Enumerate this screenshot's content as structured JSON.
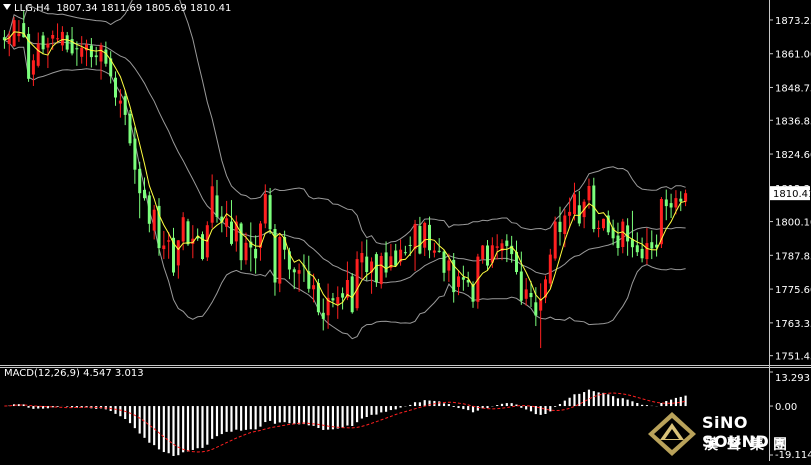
{
  "header": {
    "symbol": "LLG,H4",
    "open": "1807.34",
    "high": "1811.69",
    "low": "1805.69",
    "close": "1810.41"
  },
  "price_axis": {
    "labels": [
      "1873.25",
      "1861.00",
      "1848.75",
      "1836.85",
      "1824.60",
      "1812.35",
      "1800.10",
      "1787.85",
      "1775.60",
      "1763.35",
      "1751.45"
    ],
    "current_price": "1810.41"
  },
  "macd": {
    "label": "MACD(12,26,9) 4.547 3.013",
    "axis_labels": [
      "13.293",
      "0.00",
      "-19.114"
    ]
  },
  "logo": {
    "brand": "SiNO SOUND",
    "chinese": "漢聲集團"
  },
  "colors": {
    "background": "#000000",
    "bull_candle": "#ff2020",
    "bear_candle": "#7cff7c",
    "bollinger": "#9a9a9a",
    "moving_average": "#ffff40",
    "macd_histogram": "#ffffff",
    "macd_signal": "#ff2020",
    "current_price_label_bg": "#ffffff"
  },
  "chart_data": {
    "type": "candlestick",
    "y_range": [
      1751.45,
      1876
    ],
    "candles": [
      [
        1867,
        1869.6,
        1862.8,
        1865.9
      ],
      [
        1864.5,
        1869.1,
        1860.1,
        1867.6
      ],
      [
        1863.7,
        1874.3,
        1863.5,
        1873.2
      ],
      [
        1867.4,
        1873.2,
        1865.3,
        1868.4
      ],
      [
        1872.1,
        1876.6,
        1866.8,
        1867
      ],
      [
        1868.2,
        1870.7,
        1850.8,
        1851.9
      ],
      [
        1853.4,
        1860.8,
        1849.3,
        1858.6
      ],
      [
        1856.6,
        1868.7,
        1856,
        1864.7
      ],
      [
        1867.6,
        1868.9,
        1860.8,
        1862.6
      ],
      [
        1863.2,
        1866.8,
        1855.8,
        1864.7
      ],
      [
        1866.5,
        1869.4,
        1862.4,
        1867.8
      ],
      [
        1866.6,
        1872,
        1864.9,
        1866.6
      ],
      [
        1864,
        1871,
        1862,
        1868.9
      ],
      [
        1867.7,
        1868.9,
        1861.5,
        1862.5
      ],
      [
        1866.3,
        1870.7,
        1860.4,
        1861.1
      ],
      [
        1863,
        1865.5,
        1856.6,
        1862.6
      ],
      [
        1859.9,
        1867.4,
        1857.4,
        1863.2
      ],
      [
        1862.2,
        1866.1,
        1856.5,
        1864.3
      ],
      [
        1864,
        1866.7,
        1856,
        1859.8
      ],
      [
        1860.4,
        1863.5,
        1856.8,
        1859.8
      ],
      [
        1858.2,
        1865,
        1851.6,
        1864.1
      ],
      [
        1862.5,
        1865.4,
        1856.3,
        1857.4
      ],
      [
        1859.3,
        1861.9,
        1850.2,
        1852.8
      ],
      [
        1852.3,
        1854.6,
        1842.1,
        1845.1
      ],
      [
        1842.9,
        1848.2,
        1837.8,
        1844
      ],
      [
        1845.6,
        1847.6,
        1835.1,
        1838.8
      ],
      [
        1839.2,
        1840.6,
        1827.6,
        1828.5
      ],
      [
        1830.2,
        1834.3,
        1813.8,
        1818.9
      ],
      [
        1819.2,
        1821.8,
        1801.3,
        1810.4
      ],
      [
        1811.6,
        1816.1,
        1807.7,
        1808.6
      ],
      [
        1809.6,
        1811,
        1796.2,
        1799.3
      ],
      [
        1796.8,
        1806.1,
        1793.6,
        1804.4
      ],
      [
        1805.8,
        1808.6,
        1787.7,
        1790.5
      ],
      [
        1790.1,
        1796.7,
        1786.5,
        1791.4
      ],
      [
        1792.8,
        1796.3,
        1786.6,
        1793.3
      ],
      [
        1794.2,
        1797.8,
        1780.4,
        1781.6
      ],
      [
        1784.2,
        1793.4,
        1779.4,
        1793.3
      ],
      [
        1792.9,
        1803.5,
        1789.7,
        1801.7
      ],
      [
        1800.2,
        1801.1,
        1791.3,
        1791.9
      ],
      [
        1792,
        1798.8,
        1786.8,
        1793.9
      ],
      [
        1794.7,
        1797.6,
        1793.1,
        1794
      ],
      [
        1795.5,
        1796.5,
        1786,
        1786.5
      ],
      [
        1787.1,
        1800.2,
        1785.8,
        1798.8
      ],
      [
        1799.7,
        1817.2,
        1797.7,
        1812.9
      ],
      [
        1809.6,
        1815.2,
        1799.7,
        1801.8
      ],
      [
        1801.9,
        1805.7,
        1796.2,
        1799.9
      ],
      [
        1798.2,
        1807.6,
        1794.5,
        1801.3
      ],
      [
        1800.1,
        1807.9,
        1791.4,
        1792
      ],
      [
        1792.9,
        1802.3,
        1789.2,
        1800.1
      ],
      [
        1799.4,
        1799.9,
        1782.5,
        1786.1
      ],
      [
        1786.1,
        1796.1,
        1784.5,
        1792.4
      ],
      [
        1792.8,
        1799.8,
        1782,
        1790.7
      ],
      [
        1790.2,
        1795.1,
        1781.2,
        1786.8
      ],
      [
        1790.6,
        1800.3,
        1785.9,
        1799.4
      ],
      [
        1799.4,
        1813.6,
        1797.7,
        1810.1
      ],
      [
        1809.7,
        1812.3,
        1795.6,
        1797.3
      ],
      [
        1797.4,
        1799.2,
        1773.2,
        1778
      ],
      [
        1777.6,
        1795.8,
        1774.5,
        1794.5
      ],
      [
        1794.5,
        1796.8,
        1786.4,
        1789.9
      ],
      [
        1789.3,
        1790.6,
        1779.2,
        1782.7
      ],
      [
        1782.8,
        1783.5,
        1775.6,
        1781.7
      ],
      [
        1781.2,
        1784.9,
        1774.6,
        1782.5
      ],
      [
        1784.2,
        1788.2,
        1778.2,
        1783.9
      ],
      [
        1782.1,
        1787.7,
        1774.3,
        1775.7
      ],
      [
        1775.5,
        1781.2,
        1770.8,
        1777
      ],
      [
        1777.8,
        1779.3,
        1766.1,
        1767.2
      ],
      [
        1767,
        1772.2,
        1760.6,
        1764.8
      ],
      [
        1766.1,
        1777.6,
        1761.2,
        1772.4
      ],
      [
        1772.3,
        1774.2,
        1769,
        1771.5
      ],
      [
        1770.2,
        1776.6,
        1764.8,
        1772.7
      ],
      [
        1774.1,
        1776.2,
        1768.2,
        1772.5
      ],
      [
        1772.5,
        1785.6,
        1771.6,
        1778.9
      ],
      [
        1780.2,
        1781.4,
        1766.7,
        1767.2
      ],
      [
        1768.7,
        1789.3,
        1767.8,
        1786.5
      ],
      [
        1785.3,
        1792.9,
        1779.2,
        1788.7
      ],
      [
        1787.4,
        1793.6,
        1778.7,
        1781.8
      ],
      [
        1781.6,
        1787.1,
        1773.9,
        1785.6
      ],
      [
        1788.3,
        1789,
        1776.4,
        1778.1
      ],
      [
        1777.4,
        1788.8,
        1775.8,
        1787.6
      ],
      [
        1788.9,
        1792.9,
        1779.8,
        1781.6
      ],
      [
        1783.3,
        1792,
        1782.3,
        1787.5
      ],
      [
        1789.6,
        1792,
        1783.7,
        1784.1
      ],
      [
        1785.6,
        1793.6,
        1784.1,
        1789.9
      ],
      [
        1789,
        1791.3,
        1787.8,
        1788.9
      ],
      [
        1791.6,
        1794.7,
        1787.6,
        1791.3
      ],
      [
        1790.2,
        1800.7,
        1782.2,
        1799.2
      ],
      [
        1798.5,
        1801.8,
        1788.2,
        1788.5
      ],
      [
        1790.6,
        1800.1,
        1787.6,
        1799.6
      ],
      [
        1798.9,
        1801.9,
        1786.8,
        1789.7
      ],
      [
        1788.8,
        1792.4,
        1787.1,
        1789.6
      ],
      [
        1789.5,
        1794.1,
        1788.8,
        1789.1
      ],
      [
        1789.2,
        1789.8,
        1778.4,
        1781.5
      ],
      [
        1782.3,
        1788.5,
        1778.2,
        1786
      ],
      [
        1786.2,
        1788.7,
        1770.7,
        1774.5
      ],
      [
        1776.4,
        1782.5,
        1773.4,
        1780.2
      ],
      [
        1779.9,
        1784.1,
        1775,
        1779
      ],
      [
        1778.9,
        1781.9,
        1776.4,
        1778
      ],
      [
        1777.4,
        1778.4,
        1768.8,
        1771
      ],
      [
        1771,
        1788.4,
        1768.5,
        1787.4
      ],
      [
        1786.5,
        1791.6,
        1784.8,
        1791.4
      ],
      [
        1791.4,
        1793.4,
        1782.6,
        1784.1
      ],
      [
        1785.2,
        1794.4,
        1783.3,
        1791.5
      ],
      [
        1790.6,
        1795.5,
        1786.4,
        1791.1
      ],
      [
        1789.4,
        1793.7,
        1786.1,
        1792.2
      ],
      [
        1793.2,
        1795.5,
        1785.4,
        1791.2
      ],
      [
        1791.3,
        1794.9,
        1785.2,
        1788.3
      ],
      [
        1789.1,
        1793.2,
        1780.9,
        1781.8
      ],
      [
        1782,
        1789.2,
        1769.9,
        1771.4
      ],
      [
        1772.1,
        1779.6,
        1769.6,
        1775.5
      ],
      [
        1774.2,
        1778.5,
        1769.1,
        1772.7
      ],
      [
        1770.8,
        1776.3,
        1762.2,
        1766
      ],
      [
        1767.8,
        1777.7,
        1754.2,
        1772.2
      ],
      [
        1772.5,
        1780.5,
        1770.5,
        1779.1
      ],
      [
        1777.6,
        1790.2,
        1776.1,
        1788.1
      ],
      [
        1786.7,
        1801.9,
        1785.9,
        1800.1
      ],
      [
        1800,
        1805.5,
        1791.4,
        1796.3
      ],
      [
        1795.6,
        1804.6,
        1790.8,
        1802.3
      ],
      [
        1802.2,
        1808.8,
        1797.8,
        1803.6
      ],
      [
        1802.8,
        1814.2,
        1800.5,
        1810
      ],
      [
        1806,
        1811.2,
        1798.4,
        1799.4
      ],
      [
        1801.7,
        1808.2,
        1797.7,
        1807.3
      ],
      [
        1807.8,
        1815.7,
        1804.8,
        1813
      ],
      [
        1813.2,
        1816,
        1796.2,
        1797.4
      ],
      [
        1797.4,
        1800.5,
        1794.4,
        1797.8
      ],
      [
        1797.7,
        1801.2,
        1796.8,
        1801.1
      ],
      [
        1802.3,
        1804.1,
        1795.2,
        1796.2
      ],
      [
        1797.9,
        1800.8,
        1791.5,
        1794
      ],
      [
        1795,
        1799.7,
        1787.7,
        1790.5
      ],
      [
        1790.9,
        1801.1,
        1788.6,
        1800.1
      ],
      [
        1798.7,
        1801.3,
        1787.7,
        1792.9
      ],
      [
        1793.7,
        1804,
        1787.1,
        1790.8
      ],
      [
        1791.5,
        1796.2,
        1787.6,
        1789
      ],
      [
        1790.2,
        1794.3,
        1785.3,
        1786.8
      ],
      [
        1786.5,
        1797.8,
        1784.5,
        1792.3
      ],
      [
        1792.6,
        1796.9,
        1786.5,
        1790.3
      ],
      [
        1791.7,
        1795.4,
        1787.4,
        1790.7
      ],
      [
        1791.9,
        1809,
        1790.5,
        1808.3
      ],
      [
        1808.1,
        1811.7,
        1800.6,
        1805.7
      ],
      [
        1806.8,
        1810.2,
        1801.4,
        1805.2
      ],
      [
        1805.2,
        1811.5,
        1802.7,
        1808.6
      ],
      [
        1808.4,
        1811.1,
        1803.9,
        1807.3
      ],
      [
        1807.3,
        1811.7,
        1805.7,
        1810.4
      ]
    ]
  }
}
